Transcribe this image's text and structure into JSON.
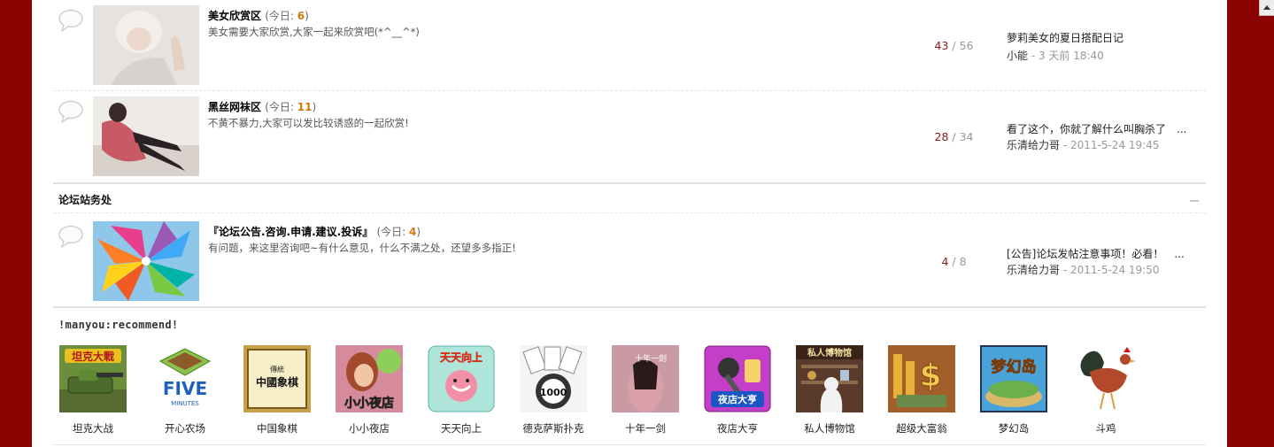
{
  "forums": [
    {
      "name": "美女欣赏区",
      "today_prefix": "(今日: ",
      "today": "6",
      "today_suffix": ")",
      "desc": "美女需要大家欣赏,大家一起来欣赏吧(*^__^*)",
      "threads": "43",
      "slash": " / ",
      "posts": "56",
      "last_title": "萝莉美女的夏日搭配日记",
      "last_user": "小能",
      "last_time": " - 3 天前 18:40"
    },
    {
      "name": "黑丝网袜区",
      "today_prefix": "(今日: ",
      "today": "11",
      "today_suffix": ")",
      "desc": "不黄不暴力,大家可以发比较诱惑的一起欣赏!",
      "threads": "28",
      "slash": " / ",
      "posts": "34",
      "last_title": "看了这个，你就了解什么叫胸杀了　...",
      "last_user": "乐清给力哥",
      "last_time": " - 2011-5-24 19:45"
    }
  ],
  "section": {
    "title": "论坛站务处"
  },
  "service_forum": {
    "name": "『论坛公告.咨询.申请.建议.投诉』",
    "today_prefix": "(今日: ",
    "today": "4",
    "today_suffix": ")",
    "desc": "有问题，来这里咨询吧~有什么意见，什么不满之处，还望多多指正!",
    "threads": "4",
    "slash": " / ",
    "posts": "8",
    "last_title": "[公告]论坛发帖注意事项！必看！　...",
    "last_user": "乐清给力哥",
    "last_time": " - 2011-5-24 19:50"
  },
  "recommend": {
    "title": "!manyou:recommend!",
    "apps": [
      {
        "label": "坦克大战",
        "icon": "tank-battle-icon"
      },
      {
        "label": "开心农场",
        "icon": "happy-farm-icon"
      },
      {
        "label": "中国象棋",
        "icon": "chinese-chess-icon"
      },
      {
        "label": "小小夜店",
        "icon": "little-nightclub-icon"
      },
      {
        "label": "天天向上",
        "icon": "tiantian-xiangshang-icon"
      },
      {
        "label": "德克萨斯扑克",
        "icon": "texas-poker-icon"
      },
      {
        "label": "十年一剑",
        "icon": "ten-year-sword-icon"
      },
      {
        "label": "夜店大亨",
        "icon": "nightclub-tycoon-icon"
      },
      {
        "label": "私人博物馆",
        "icon": "private-museum-icon"
      },
      {
        "label": "超级大富翁",
        "icon": "super-monopoly-icon"
      },
      {
        "label": "梦幻岛",
        "icon": "dream-island-icon"
      },
      {
        "label": "斗鸡",
        "icon": "cockfight-icon"
      }
    ]
  },
  "colors": {
    "frame": "#8b0000",
    "today_count": "#d27a0c",
    "thread_count": "#8b1a1a"
  }
}
